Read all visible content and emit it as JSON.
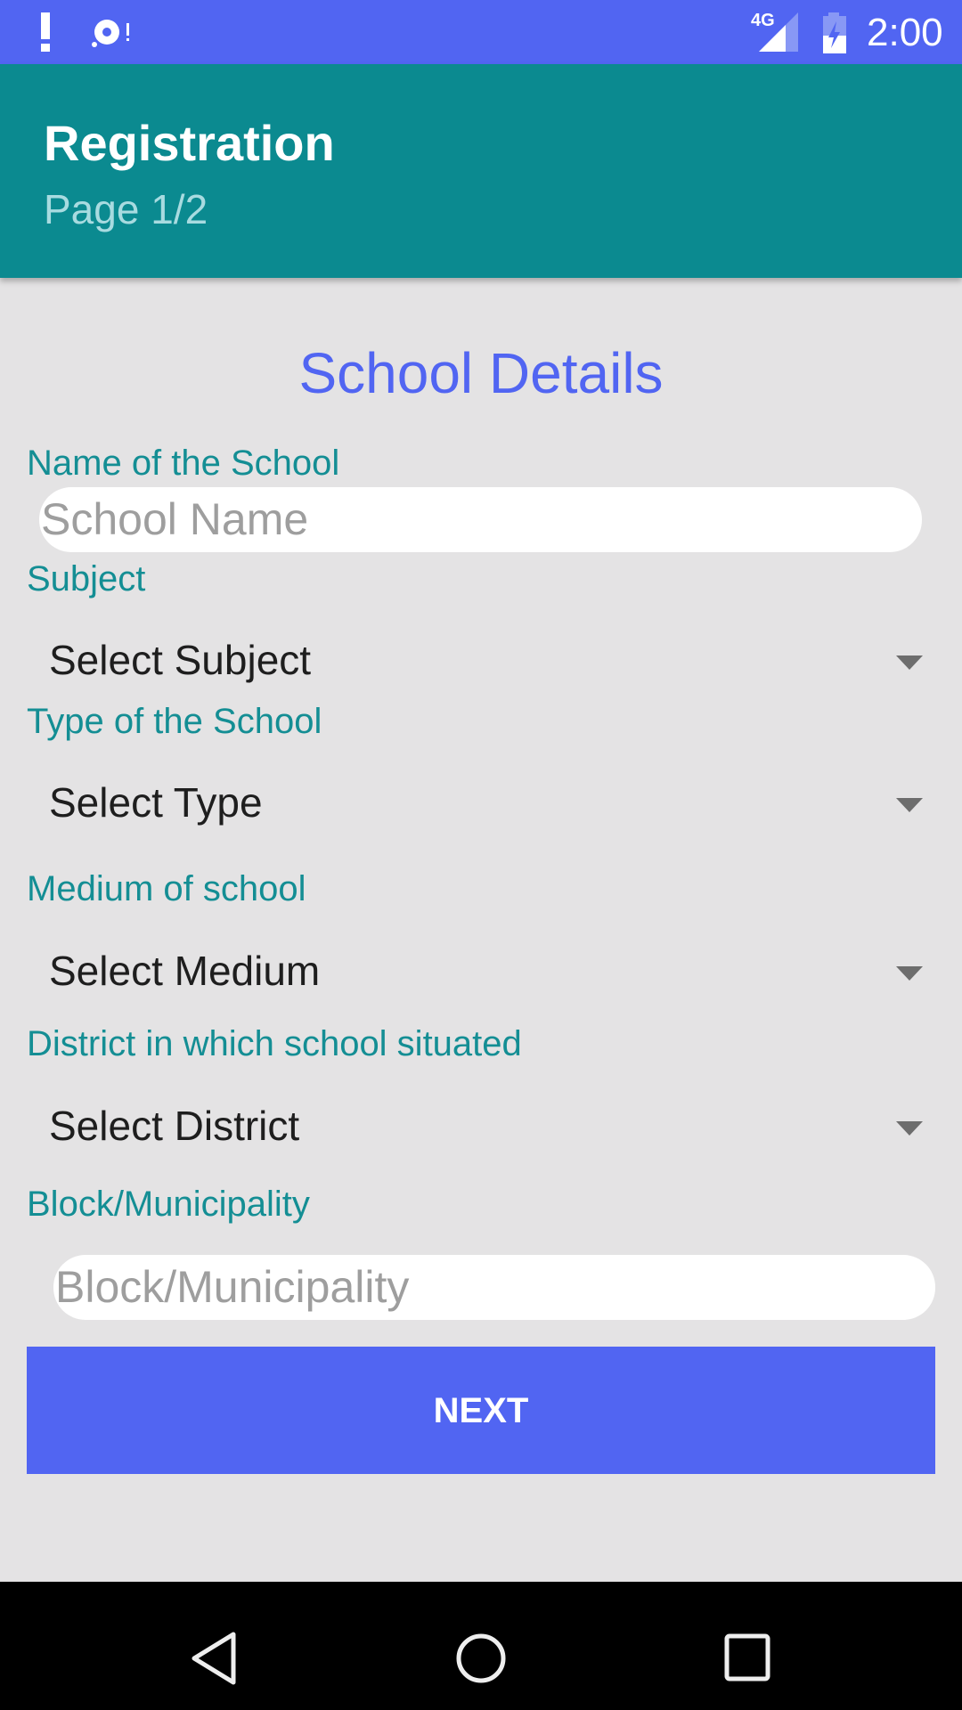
{
  "status_bar": {
    "time": "2:00",
    "network": "4G",
    "icons": [
      "alert-icon",
      "sync-problem-icon",
      "signal-4g-icon",
      "battery-charging-icon"
    ]
  },
  "app_bar": {
    "title": "Registration",
    "subtitle": "Page 1/2"
  },
  "form": {
    "heading": "School Details",
    "school_name": {
      "label": "Name of the School",
      "placeholder": "School Name",
      "value": ""
    },
    "subject": {
      "label": "Subject",
      "selected": "Select Subject"
    },
    "school_type": {
      "label": "Type of the School",
      "selected": "Select Type"
    },
    "medium": {
      "label": "Medium of school",
      "selected": "Select Medium"
    },
    "district": {
      "label": "District in which school situated",
      "selected": "Select District"
    },
    "block": {
      "label": "Block/Municipality",
      "placeholder": "Block/Municipality",
      "value": ""
    },
    "next_label": "NEXT"
  },
  "colors": {
    "status_bar": "#5165f2",
    "app_bar": "#0b8a90",
    "accent": "#5165f2",
    "label": "#148e94",
    "background": "#e4e3e4"
  },
  "nav_bar": {
    "icons": [
      "back-icon",
      "home-icon",
      "recents-icon"
    ]
  }
}
